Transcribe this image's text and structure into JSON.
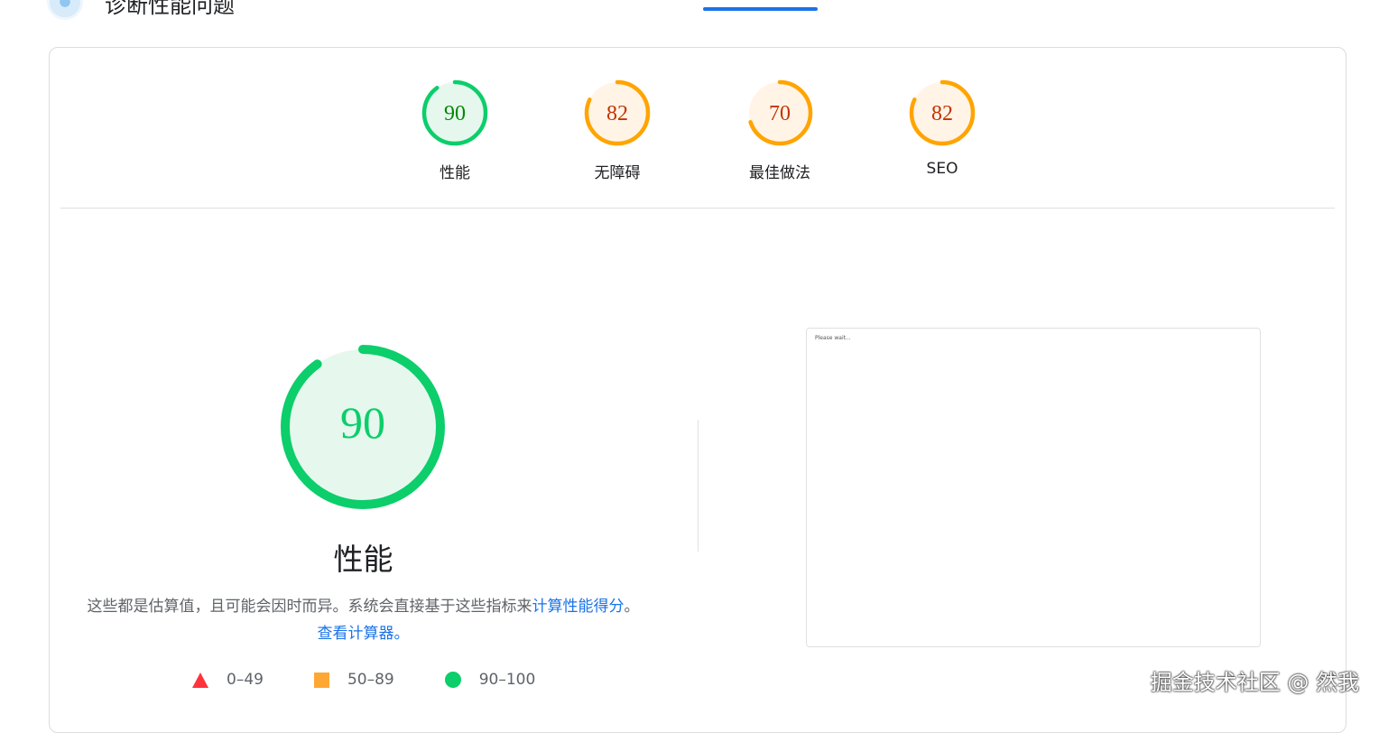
{
  "header": {
    "title": "诊断性能问题"
  },
  "gauges": [
    {
      "score": "90",
      "label": "性能",
      "fill_fraction": 0.9,
      "color": "#0cce6b",
      "bg": "#e6f8ee",
      "text_color": "#008800"
    },
    {
      "score": "82",
      "label": "无障碍",
      "fill_fraction": 0.82,
      "color": "#ffa400",
      "bg": "#fff4e6",
      "text_color": "#c33300"
    },
    {
      "score": "70",
      "label": "最佳做法",
      "fill_fraction": 0.7,
      "color": "#ffa400",
      "bg": "#fff4e6",
      "text_color": "#c33300"
    },
    {
      "score": "82",
      "label": "SEO",
      "fill_fraction": 0.82,
      "color": "#ffa400",
      "bg": "#fff4e6",
      "text_color": "#c33300"
    }
  ],
  "main": {
    "score": "90",
    "fill_fraction": 0.9,
    "title": "性能",
    "desc_prefix": "这些都是估算值，且可能会因时而异。系统会直接基于这些指标来",
    "desc_link1": "计算性能得分",
    "desc_mid": "。",
    "desc_link2": "查看计算器。",
    "colors": {
      "ring": "#0cce6b",
      "bg": "#e6f8ee",
      "text": "#0cce6b"
    }
  },
  "legend": [
    {
      "icon": "triangle-icon",
      "range": "0–49",
      "color": "#ff333d"
    },
    {
      "icon": "square-icon",
      "range": "50–89",
      "color": "#ffa734"
    },
    {
      "icon": "circle-icon",
      "range": "90–100",
      "color": "#0cce6b"
    }
  ],
  "screenshot": {
    "text": "Please wait..."
  },
  "watermark": "掘金技术社区 @ 然我"
}
